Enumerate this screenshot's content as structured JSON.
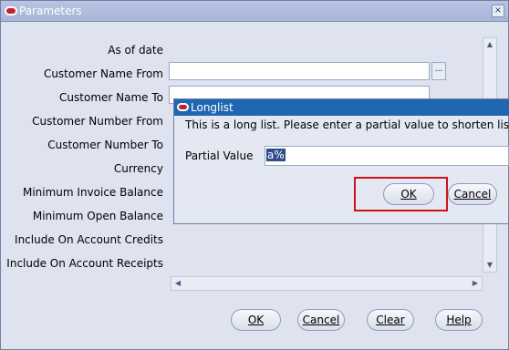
{
  "window": {
    "title": "Parameters",
    "close_label": "×"
  },
  "form": {
    "labels": [
      "As of date",
      "Customer Name From",
      "Customer Name To",
      "Customer Number From",
      "Customer Number To",
      "Currency",
      "Minimum Invoice Balance",
      "Minimum Open Balance",
      "Include On Account Credits",
      "Include On Account Receipts"
    ],
    "lov_label": "...",
    "buttons": {
      "ok": "OK",
      "cancel": "Cancel",
      "clear": "Clear",
      "help": "Help"
    }
  },
  "dialog": {
    "title": "Longlist",
    "message": "This is a long list. Please enter a partial value to shorten list",
    "partial_value_label": "Partial Value",
    "partial_value": "a%",
    "ok_label": "OK",
    "cancel_label": "Cancel"
  },
  "colors": {
    "titlebar": "#a7b5d8",
    "dialog_titlebar": "#1f67b1",
    "highlight": "#d0121b"
  }
}
